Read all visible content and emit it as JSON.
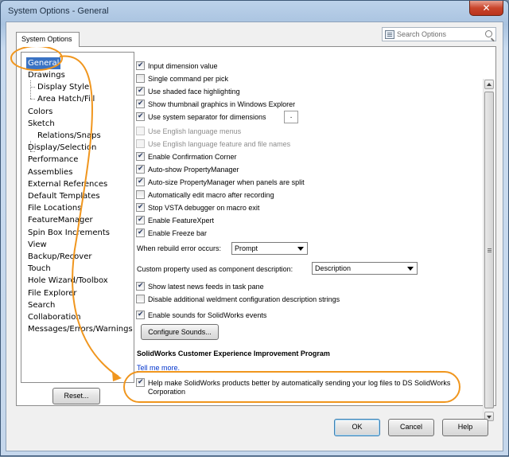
{
  "window": {
    "title": "System Options - General",
    "close_glyph": "✕",
    "tab_label": "System Options"
  },
  "search": {
    "placeholder": "Search Options"
  },
  "tree": {
    "items": [
      {
        "label": "General",
        "level": 0,
        "selected": true
      },
      {
        "label": "Drawings",
        "level": 0
      },
      {
        "label": "Display Style",
        "level": 1
      },
      {
        "label": "Area Hatch/Fill",
        "level": 1
      },
      {
        "label": "Colors",
        "level": 0
      },
      {
        "label": "Sketch",
        "level": 0
      },
      {
        "label": "Relations/Snaps",
        "level": 1
      },
      {
        "label": "Display/Selection",
        "level": 0
      },
      {
        "label": "Performance",
        "level": 0
      },
      {
        "label": "Assemblies",
        "level": 0
      },
      {
        "label": "External References",
        "level": 0
      },
      {
        "label": "Default Templates",
        "level": 0
      },
      {
        "label": "File Locations",
        "level": 0
      },
      {
        "label": "FeatureManager",
        "level": 0
      },
      {
        "label": "Spin Box Increments",
        "level": 0
      },
      {
        "label": "View",
        "level": 0
      },
      {
        "label": "Backup/Recover",
        "level": 0
      },
      {
        "label": "Touch",
        "level": 0
      },
      {
        "label": "Hole Wizard/Toolbox",
        "level": 0
      },
      {
        "label": "File Explorer",
        "level": 0
      },
      {
        "label": "Search",
        "level": 0
      },
      {
        "label": "Collaboration",
        "level": 0
      },
      {
        "label": "Messages/Errors/Warnings",
        "level": 0
      }
    ],
    "reset_label": "Reset..."
  },
  "options": {
    "checkboxes": [
      {
        "label": "Input dimension value",
        "checked": true,
        "enabled": true
      },
      {
        "label": "Single command per pick",
        "checked": false,
        "enabled": true
      },
      {
        "label": "Use shaded face highlighting",
        "checked": true,
        "enabled": true
      },
      {
        "label": "Show thumbnail graphics in Windows Explorer",
        "checked": true,
        "enabled": true
      },
      {
        "label": "Use system separator for dimensions",
        "checked": true,
        "enabled": true
      },
      {
        "label": "Use English language menus",
        "checked": false,
        "enabled": false
      },
      {
        "label": "Use English language feature and file names",
        "checked": false,
        "enabled": false
      },
      {
        "label": "Enable Confirmation Corner",
        "checked": true,
        "enabled": true
      },
      {
        "label": "Auto-show PropertyManager",
        "checked": true,
        "enabled": true
      },
      {
        "label": "Auto-size PropertyManager when panels are split",
        "checked": true,
        "enabled": true
      },
      {
        "label": "Automatically edit macro after recording",
        "checked": false,
        "enabled": true
      },
      {
        "label": "Stop VSTA debugger on macro exit",
        "checked": true,
        "enabled": true
      },
      {
        "label": "Enable FeatureXpert",
        "checked": true,
        "enabled": true
      },
      {
        "label": "Enable Freeze bar",
        "checked": true,
        "enabled": true
      }
    ],
    "separator_value": ".",
    "rebuild_label": "When rebuild error occurs:",
    "rebuild_value": "Prompt",
    "custom_prop_label": "Custom property used as component description:",
    "custom_prop_value": "Description",
    "news_feeds": {
      "label": "Show latest news feeds in task pane",
      "checked": true
    },
    "disable_weldment": {
      "label": "Disable additional weldment configuration description strings",
      "checked": false
    },
    "enable_sounds": {
      "label": "Enable sounds for SolidWorks events",
      "checked": true
    },
    "configure_sounds_label": "Configure Sounds...",
    "ceip_heading": "SolidWorks Customer Experience Improvement Program",
    "tell_me_more": "Tell me more.",
    "help_make": {
      "label_line1": "Help make SolidWorks products better by automatically sending your log files to DS SolidWorks",
      "label_line2": "Corporation",
      "checked": true
    }
  },
  "footer": {
    "ok_label": "OK",
    "cancel_label": "Cancel",
    "help_label": "Help"
  },
  "colors": {
    "annotation": "#f0961e",
    "selection": "#3a73c4",
    "link": "#0033cc"
  }
}
